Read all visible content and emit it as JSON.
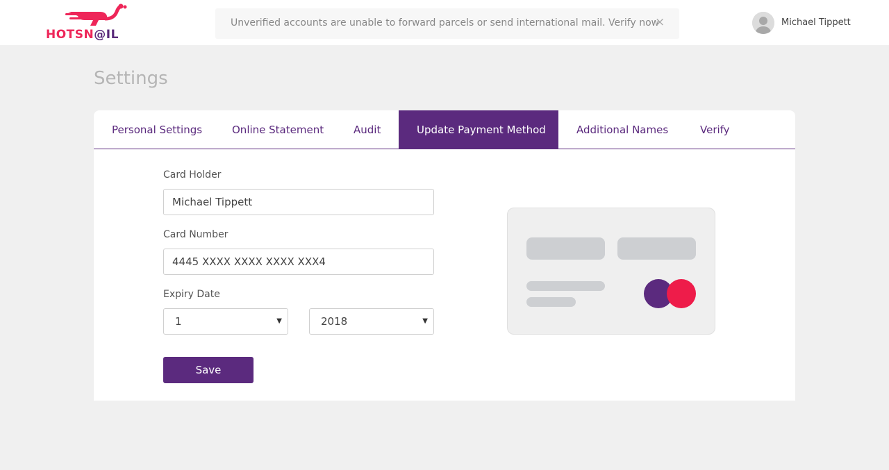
{
  "brand": {
    "logo_text_hot": "HOTSN",
    "logo_text_rest": "@IL",
    "primary_color": "#5b2a7e",
    "accent_color": "#ee2659"
  },
  "notice": {
    "text": "Unverified accounts are unable to forward parcels or send international mail. Verify now",
    "close_label": "×"
  },
  "user": {
    "name": "Michael Tippett"
  },
  "page": {
    "title": "Settings"
  },
  "tabs": [
    {
      "label": "Personal Settings",
      "active": false
    },
    {
      "label": "Online Statement",
      "active": false
    },
    {
      "label": "Audit",
      "active": false
    },
    {
      "label": "Update Payment Method",
      "active": true
    },
    {
      "label": "Additional Names",
      "active": false
    },
    {
      "label": "Verify",
      "active": false
    }
  ],
  "form": {
    "card_holder_label": "Card Holder",
    "card_holder_value": "Michael Tippett",
    "card_number_label": "Card Number",
    "card_number_value": "4445 XXXX XXXX XXXX XXX4",
    "expiry_label": "Expiry Date",
    "expiry_month": "1",
    "expiry_year": "2018",
    "save_label": "Save"
  },
  "card_illustration": {
    "circle_left_color": "#5b2a7e",
    "circle_right_color": "#ee1c4a"
  }
}
